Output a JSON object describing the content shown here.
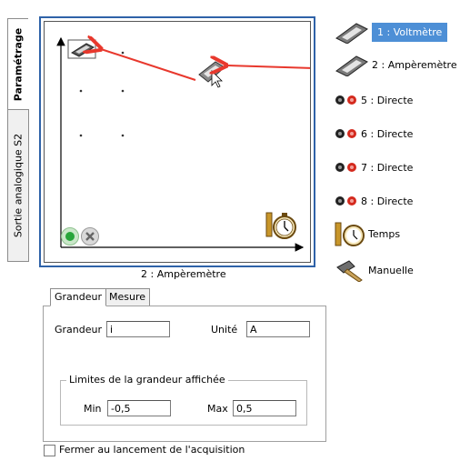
{
  "side_tabs": [
    "Paramétrage",
    "Sortie analogique S2"
  ],
  "sensors": [
    {
      "label": "1 : Voltmètre",
      "icon": "voltmeter-icon",
      "selected": true
    },
    {
      "label": "2 : Ampèremètre",
      "icon": "ammeter-icon",
      "selected": false
    },
    {
      "label": "5 : Directe",
      "icon": "direct-input-icon",
      "selected": false
    },
    {
      "label": "6 : Directe",
      "icon": "direct-input-icon",
      "selected": false
    },
    {
      "label": "7 : Directe",
      "icon": "direct-input-icon",
      "selected": false
    },
    {
      "label": "8 : Directe",
      "icon": "direct-input-icon",
      "selected": false
    },
    {
      "label": "Temps",
      "icon": "stopwatch-icon",
      "selected": false
    },
    {
      "label": "Manuelle",
      "icon": "hammer-icon",
      "selected": false
    }
  ],
  "plot": {
    "x_axis_label": "2 : Ampèremètre"
  },
  "property_tabs": [
    "Grandeur",
    "Mesure"
  ],
  "grandeur": {
    "grandeur_label": "Grandeur",
    "grandeur_value": "i",
    "unite_label": "Unité",
    "unite_value": "A"
  },
  "limits": {
    "title": "Limites de la grandeur affichée",
    "min_label": "Min",
    "min_value": "-0,5",
    "max_label": "Max",
    "max_value": "0,5"
  },
  "close_option": {
    "label": "Fermer au lancement de l'acquisition",
    "checked": false
  },
  "colors": {
    "frame_blue": "#2f62a8",
    "selection_blue": "#4d8fd6",
    "arrow_red": "#e8382d"
  }
}
